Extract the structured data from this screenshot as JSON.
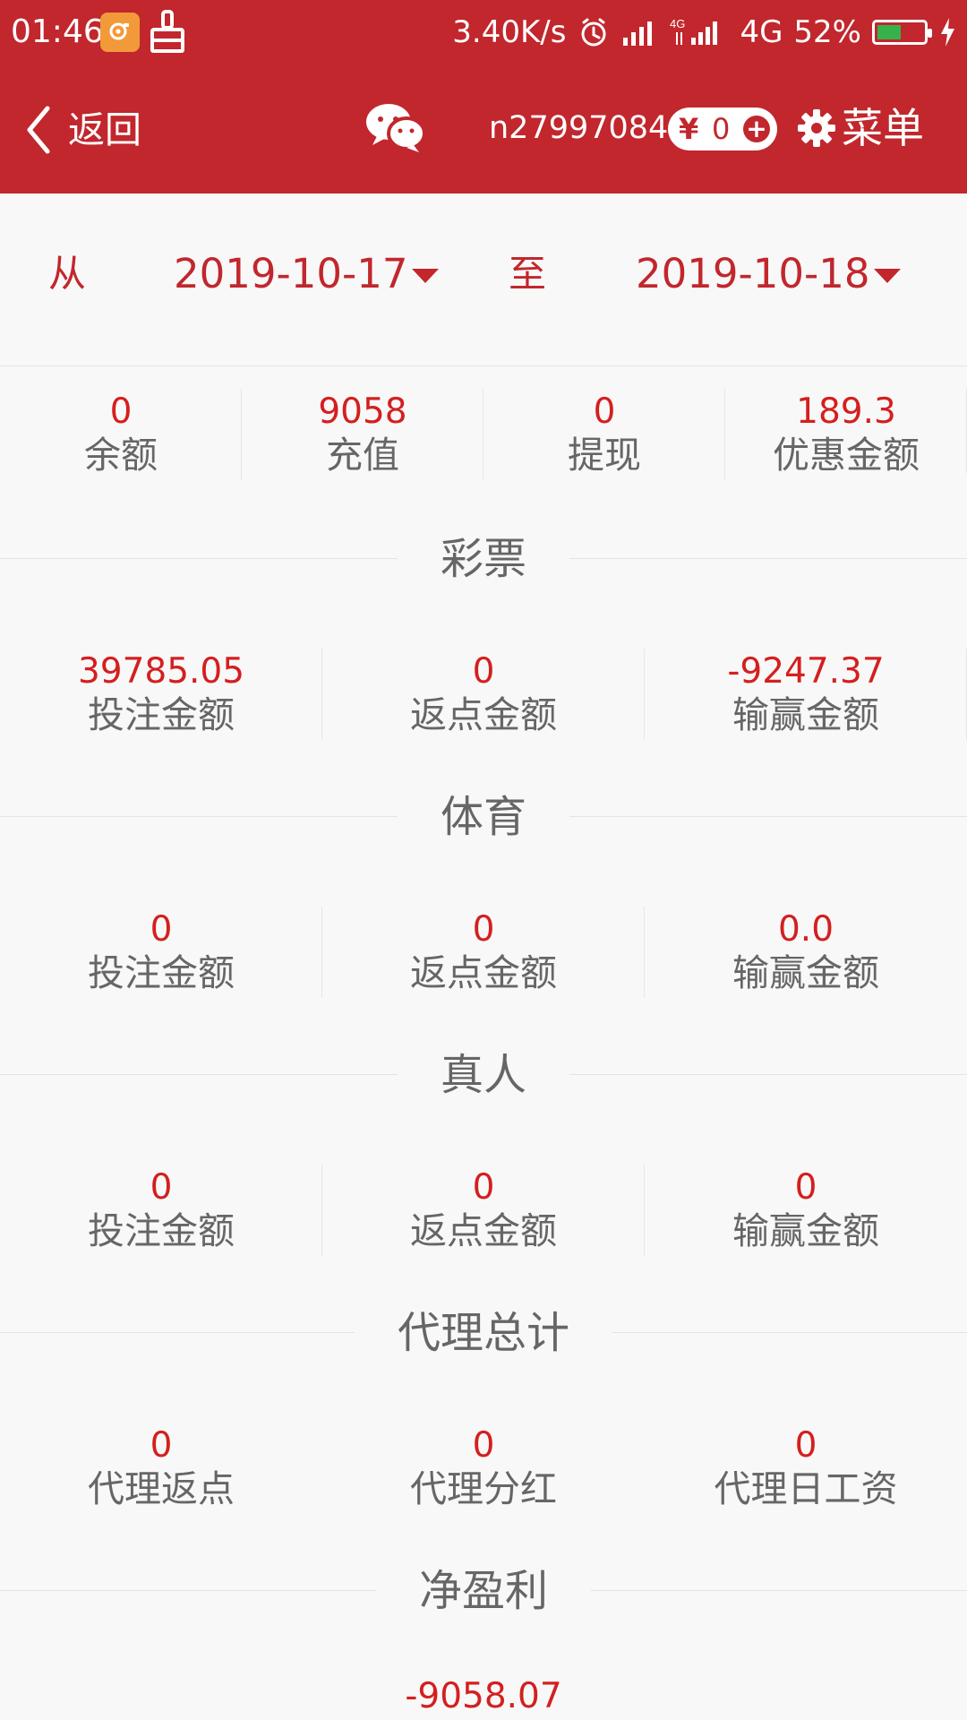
{
  "status_bar": {
    "time": "01:46",
    "network_speed": "3.40K/s",
    "network_type": "4G",
    "battery_percent": "52%",
    "battery_level": 0.52,
    "icons": [
      "camera-app-icon",
      "cleaner-icon",
      "alarm-icon",
      "signal-icon",
      "4g-signal-icon",
      "battery-icon",
      "charging-icon"
    ]
  },
  "header": {
    "back_label": "返回",
    "account": "n279970848",
    "wallet_currency": "¥",
    "wallet_balance": "0",
    "wallet_add": "+",
    "menu_label": "菜单",
    "icons": [
      "back-icon",
      "wechat-icon",
      "gear-icon",
      "plus-icon"
    ]
  },
  "date_filter": {
    "from_label": "从",
    "start_date": "2019-10-17",
    "to_label": "至",
    "end_date": "2019-10-18"
  },
  "summary": [
    {
      "value": "0",
      "label": "余额"
    },
    {
      "value": "9058",
      "label": "充值"
    },
    {
      "value": "0",
      "label": "提现"
    },
    {
      "value": "189.3",
      "label": "优惠金额"
    }
  ],
  "sections": [
    {
      "title": "彩票",
      "items": [
        {
          "value": "39785.05",
          "label": "投注金额"
        },
        {
          "value": "0",
          "label": "返点金额"
        },
        {
          "value": "-9247.37",
          "label": "输赢金额"
        }
      ]
    },
    {
      "title": "体育",
      "items": [
        {
          "value": "0",
          "label": "投注金额"
        },
        {
          "value": "0",
          "label": "返点金额"
        },
        {
          "value": "0.0",
          "label": "输赢金额"
        }
      ]
    },
    {
      "title": "真人",
      "items": [
        {
          "value": "0",
          "label": "投注金额"
        },
        {
          "value": "0",
          "label": "返点金额"
        },
        {
          "value": "0",
          "label": "输赢金额"
        }
      ]
    },
    {
      "title": "代理总计",
      "items": [
        {
          "value": "0",
          "label": "代理返点"
        },
        {
          "value": "0",
          "label": "代理分红"
        },
        {
          "value": "0",
          "label": "代理日工资"
        }
      ]
    }
  ],
  "net_profit": {
    "title": "净盈利",
    "value": "-9058.07"
  },
  "colors": {
    "brand_red": "#c1272d",
    "value_red": "#d41f1f",
    "background": "#f8f8f8",
    "label_gray": "#666666",
    "battery_green": "#35b34a"
  }
}
